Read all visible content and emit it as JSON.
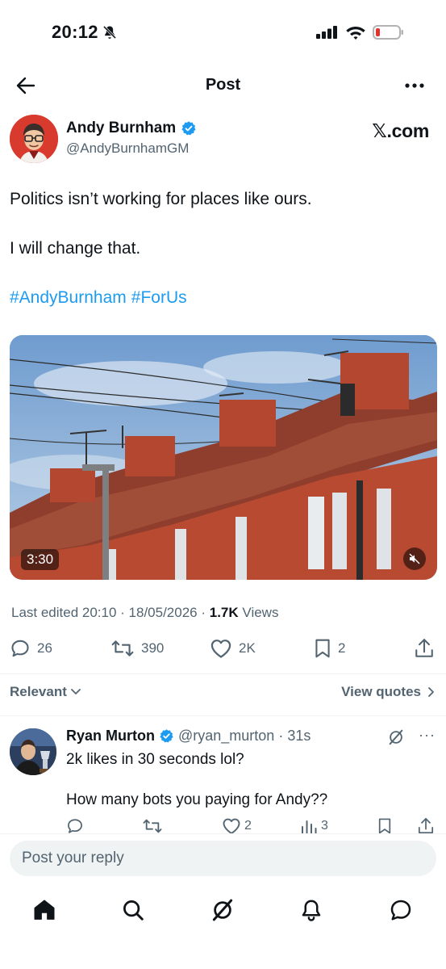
{
  "status_bar": {
    "time": "20:12",
    "icons": [
      "bell-off-icon",
      "cellular-signal-icon",
      "wifi-icon",
      "battery-low-icon"
    ],
    "battery_color": "#e5322d"
  },
  "nav": {
    "title": "Post",
    "back_icon": "arrow-left-icon",
    "more_icon": "more-horizontal-icon"
  },
  "author": {
    "name": "Andy Burnham",
    "handle": "@AndyBurnhamGM",
    "verified": true
  },
  "source_watermark": "𝕏.com",
  "tweet": {
    "line1": "Politics isn’t working for places like ours.",
    "line2": "I will change that.",
    "hashtags": [
      "#AndyBurnham",
      "#ForUs"
    ]
  },
  "media": {
    "duration": "3:30",
    "muted": true
  },
  "meta": {
    "edited_label": "Last edited 20:10 · 18/05/2026",
    "separator": " · ",
    "views_count": "1.7K",
    "views_label": "Views"
  },
  "engagement": {
    "replies": "26",
    "reposts": "390",
    "likes": "2K",
    "bookmarks": "2"
  },
  "sort": {
    "relevant_label": "Relevant",
    "view_quotes_label": "View quotes"
  },
  "reply": {
    "name": "Ryan Murton",
    "handle": "@ryan_murton",
    "time": "· 31s",
    "verified": true,
    "text_line1": "2k likes in 30 seconds lol?",
    "text_line2": "How many bots you paying for Andy??",
    "likes": "2",
    "views": "3",
    "more": "···"
  },
  "compose": {
    "placeholder": "Post your reply"
  },
  "tabs": [
    "home-icon",
    "search-icon",
    "grok-icon",
    "notifications-icon",
    "messages-icon"
  ],
  "colors": {
    "accent": "#1d9bf0",
    "text_primary": "#0f1419",
    "text_secondary": "#536471",
    "divider": "#eff3f4",
    "brick": "#b84a32",
    "sky": "#8ab0d8"
  }
}
